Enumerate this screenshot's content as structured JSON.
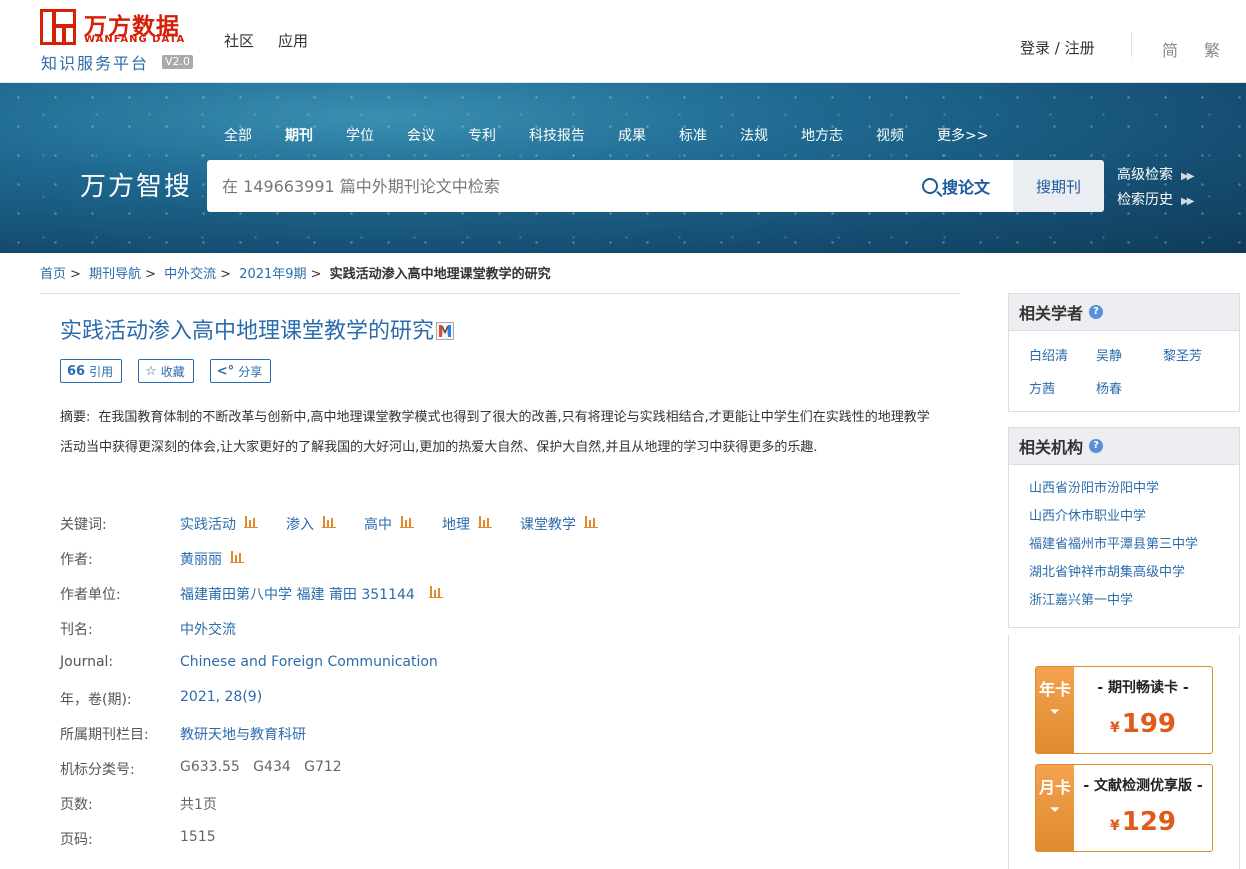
{
  "header": {
    "logo_cn": "万方数据",
    "logo_en": "WANFANG DATA",
    "logo_sub": "知识服务平台",
    "logo_version": "V2.0",
    "nav": [
      "社区",
      "应用"
    ],
    "login": "登录 / 注册",
    "lang_simplified": "简",
    "lang_traditional": "繁"
  },
  "banner": {
    "types": [
      "全部",
      "期刊",
      "学位",
      "会议",
      "专利",
      "科技报告",
      "成果",
      "标准",
      "法规",
      "地方志",
      "视频",
      "更多>>"
    ],
    "active_type": "期刊",
    "brand": "万方智搜",
    "search_placeholder": "在 149663991 篇中外期刊论文中检索",
    "search_paper": "搜论文",
    "search_journal": "搜期刊",
    "advanced": "高级检索",
    "history": "检索历史"
  },
  "breadcrumb": [
    "首页",
    "期刊导航",
    "中外交流",
    "2021年9期"
  ],
  "breadcrumb_current": "实践活动渗入高中地理课堂教学的研究",
  "article": {
    "title": "实践活动渗入高中地理课堂教学的研究",
    "actions": {
      "cite": "引用",
      "favorite": "收藏",
      "share": "分享"
    },
    "abstract_label": "摘要:",
    "abstract": "在我国教育体制的不断改革与创新中,高中地理课堂教学模式也得到了很大的改善,只有将理论与实践相结合,才更能让中学生们在实践性的地理教学活动当中获得更深刻的体会,让大家更好的了解我国的大好河山,更加的热爱大自然、保护大自然,并且从地理的学习中获得更多的乐趣.",
    "keywords_label": "关键词:",
    "keywords": [
      "实践活动",
      "渗入",
      "高中",
      "地理",
      "课堂教学"
    ],
    "author_label": "作者:",
    "author": "黄丽丽",
    "affiliation_label": "作者单位:",
    "affiliation": "福建莆田第八中学 福建 莆田 351144",
    "journal_cn_label": "刊名:",
    "journal_cn": "中外交流",
    "journal_en_label": "Journal:",
    "journal_en": "Chinese and Foreign Communication",
    "year_label": "年，卷(期):",
    "year": "2021, 28(9)",
    "column_label": "所属期刊栏目:",
    "column": "教研天地与教育科研",
    "clc_label": "机标分类号:",
    "clc": "G633.55   G434   G712",
    "pages_label": "页数:",
    "pages": "共1页",
    "page_no_label": "页码:",
    "page_no": "1515"
  },
  "sidebar": {
    "scholars_title": "相关学者",
    "scholars": [
      "白绍清",
      "吴静",
      "黎圣芳",
      "方茜",
      "杨春"
    ],
    "orgs_title": "相关机构",
    "orgs": [
      "山西省汾阳市汾阳中学",
      "山西介休市职业中学",
      "福建省福州市平潭县第三中学",
      "湖北省钟祥市胡集高级中学",
      "浙江嘉兴第一中学"
    ],
    "card_year": {
      "tag": "年卡",
      "title": "- 期刊畅读卡 -",
      "currency": "¥",
      "price": "199"
    },
    "card_month": {
      "tag": "月卡",
      "title": "- 文献检测优享版 -",
      "currency": "¥",
      "price": "129"
    }
  }
}
